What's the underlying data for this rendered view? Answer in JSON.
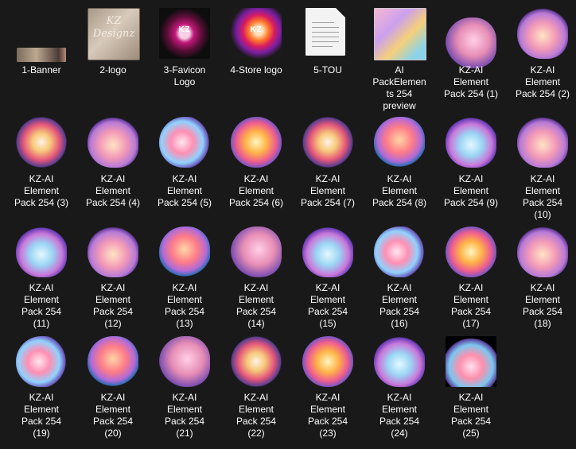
{
  "files": [
    {
      "label": "1-Banner",
      "icon": "banner-image-icon"
    },
    {
      "label": "2-logo",
      "icon": "logo-image-icon",
      "art_text": "KZ\nDesignz"
    },
    {
      "label": "3-Favicon\nLogo",
      "icon": "favicon-image-icon",
      "art_text": "KZ"
    },
    {
      "label": "4-Store logo",
      "icon": "store-logo-image-icon",
      "art_text": "KZ"
    },
    {
      "label": "5-TOU",
      "icon": "text-document-icon"
    },
    {
      "label": "AI\nPackElemen\nts 254\npreview",
      "icon": "preview-image-icon"
    },
    {
      "label": "KZ-AI\nElement\nPack 254 (1)",
      "icon": "dolphin-image-icon"
    },
    {
      "label": "KZ-AI\nElement\nPack 254 (2)",
      "icon": "octopus-image-icon"
    },
    {
      "label": "KZ-AI\nElement\nPack 254 (3)",
      "icon": "pirate-skull-image-icon"
    },
    {
      "label": "KZ-AI\nElement\nPack 254 (4)",
      "icon": "shells-image-icon"
    },
    {
      "label": "KZ-AI\nElement\nPack 254 (5)",
      "icon": "shell-cluster-image-icon"
    },
    {
      "label": "KZ-AI\nElement\nPack 254 (6)",
      "icon": "ship-image-icon"
    },
    {
      "label": "KZ-AI\nElement\nPack 254 (7)",
      "icon": "mermaid-image-icon"
    },
    {
      "label": "KZ-AI\nElement\nPack 254 (8)",
      "icon": "fish-image-icon"
    },
    {
      "label": "KZ-AI\nElement\nPack 254 (9)",
      "icon": "shipwreck-image-icon"
    },
    {
      "label": "KZ-AI\nElement\nPack 254\n(10)",
      "icon": "clam-image-icon"
    },
    {
      "label": "KZ-AI\nElement\nPack 254\n(11)",
      "icon": "crab-image-icon"
    },
    {
      "label": "KZ-AI\nElement\nPack 254\n(12)",
      "icon": "coral-clam-image-icon"
    },
    {
      "label": "KZ-AI\nElement\nPack 254\n(13)",
      "icon": "angelfish-image-icon"
    },
    {
      "label": "KZ-AI\nElement\nPack 254\n(14)",
      "icon": "octopus-coral-image-icon"
    },
    {
      "label": "KZ-AI\nElement\nPack 254\n(15)",
      "icon": "shark-image-icon"
    },
    {
      "label": "KZ-AI\nElement\nPack 254\n(16)",
      "icon": "coral-image-icon"
    },
    {
      "label": "KZ-AI\nElement\nPack 254\n(17)",
      "icon": "anemone-image-icon"
    },
    {
      "label": "KZ-AI\nElement\nPack 254\n(18)",
      "icon": "castle-image-icon"
    },
    {
      "label": "KZ-AI\nElement\nPack 254\n(19)",
      "icon": "coral-reef-image-icon"
    },
    {
      "label": "KZ-AI\nElement\nPack 254\n(20)",
      "icon": "coral-tree-image-icon"
    },
    {
      "label": "KZ-AI\nElement\nPack 254\n(21)",
      "icon": "flower-coral-image-icon"
    },
    {
      "label": "KZ-AI\nElement\nPack 254\n(22)",
      "icon": "seahorse-image-icon"
    },
    {
      "label": "KZ-AI\nElement\nPack 254\n(23)",
      "icon": "tropical-fish-image-icon"
    },
    {
      "label": "KZ-AI\nElement\nPack 254\n(24)",
      "icon": "heart-coral-image-icon"
    },
    {
      "label": "KZ-AI\nElement\nPack 254\n(25)",
      "icon": "reef-scene-image-icon"
    }
  ]
}
